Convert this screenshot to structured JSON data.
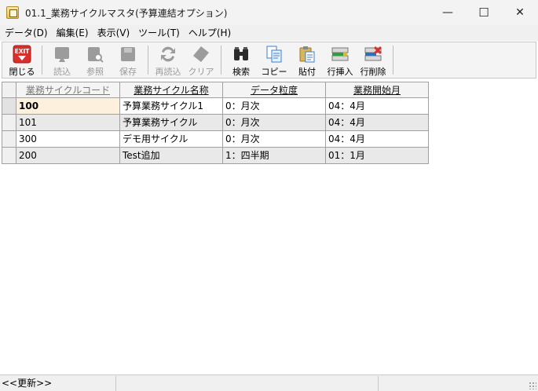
{
  "window": {
    "title": "01.1_業務サイクルマスタ(予算連結オプション)",
    "minimize_glyph": "—",
    "maximize_glyph": "☐",
    "close_glyph": "✕"
  },
  "menu": [
    {
      "label": "データ(D)"
    },
    {
      "label": "編集(E)"
    },
    {
      "label": "表示(V)"
    },
    {
      "label": "ツール(T)"
    },
    {
      "label": "ヘルプ(H)"
    }
  ],
  "toolbar": {
    "close": {
      "label": "閉じる",
      "icon": "exit-icon",
      "badge": "EXIT"
    },
    "read": {
      "label": "読込",
      "icon": "read-icon"
    },
    "ref": {
      "label": "参照",
      "icon": "reference-icon"
    },
    "save": {
      "label": "保存",
      "icon": "save-icon"
    },
    "reread": {
      "label": "再読込",
      "icon": "reload-icon"
    },
    "clear": {
      "label": "クリア",
      "icon": "eraser-icon"
    },
    "search": {
      "label": "検索",
      "icon": "binoculars-icon"
    },
    "copy": {
      "label": "コピー",
      "icon": "copy-icon"
    },
    "paste": {
      "label": "貼付",
      "icon": "paste-icon"
    },
    "insert": {
      "label": "行挿入",
      "icon": "insert-row-icon"
    },
    "delete": {
      "label": "行削除",
      "icon": "delete-row-icon"
    }
  },
  "grid": {
    "columns": [
      "業務サイクルコード",
      "業務サイクル名称",
      "データ粒度",
      "業務開始月"
    ],
    "rows": [
      [
        "100",
        "予算業務サイクル1",
        "0：月次",
        "04：4月"
      ],
      [
        "101",
        "予算業務サイクル",
        "0：月次",
        "04：4月"
      ],
      [
        "300",
        "デモ用サイクル",
        "0：月次",
        "04：4月"
      ],
      [
        "200",
        "Test追加",
        "1：四半期",
        "01：1月"
      ]
    ]
  },
  "status": {
    "text": "<<更新>>"
  },
  "colors": {
    "selected_cell": "#fdf0dc",
    "alt_row": "#e9e9e9",
    "exit_red": "#d9302c"
  }
}
